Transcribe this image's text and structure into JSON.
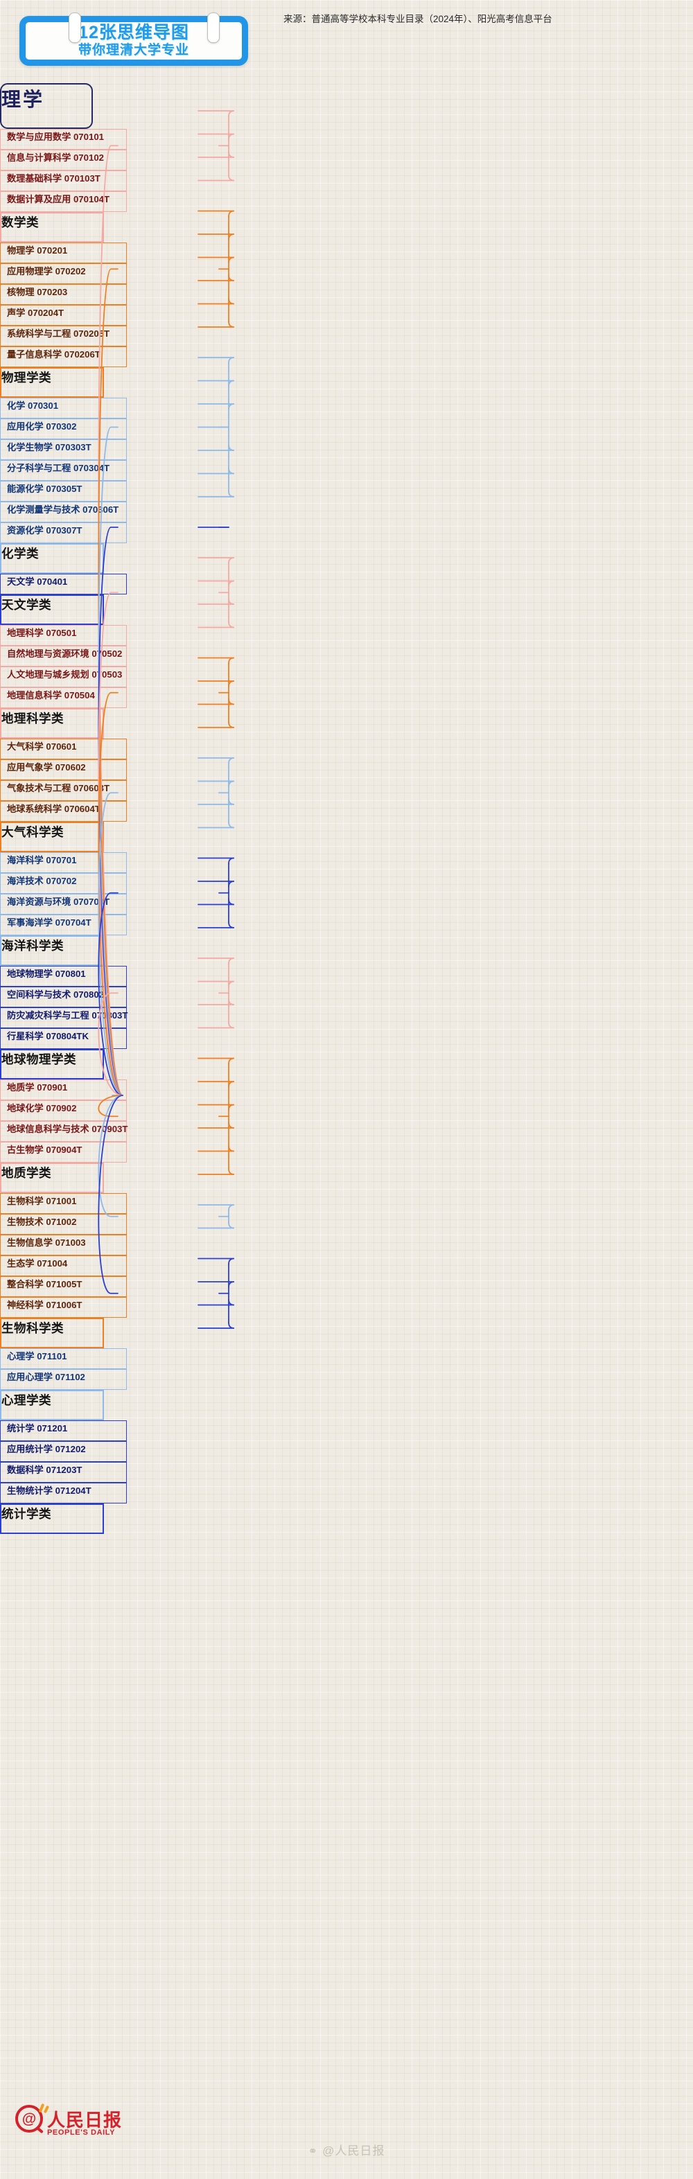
{
  "header": {
    "title_line1": "12张思维导图",
    "title_line2": "带你理清大学专业",
    "source": "来源：普通高等学校本科专业目录（2024年）、阳光高考信息平台"
  },
  "footer": {
    "logo_cn": "人民日报",
    "logo_en": "PEOPLE'S DAILY",
    "logo_mark": "@",
    "watermark": "@人民日报",
    "watermark_icon": "weibo-icon"
  },
  "mindmap": {
    "root": "理学",
    "root_color": "#262a62",
    "categories": [
      {
        "name": "数学类",
        "color": "#f4a9a3",
        "text_color": "#7b1516",
        "leaves": [
          "数学与应用数学 070101",
          "信息与计算科学 070102",
          "数理基础科学 070103T",
          "数据计算及应用 070104T"
        ]
      },
      {
        "name": "物理学类",
        "color": "#f07f22",
        "text_color": "#5e2409",
        "leaves": [
          "物理学 070201",
          "应用物理学 070202",
          "核物理 070203",
          "声学 070204T",
          "系统科学与工程 070205T",
          "量子信息科学 070206T"
        ]
      },
      {
        "name": "化学类",
        "color": "#8fb9ea",
        "text_color": "#10357a",
        "leaves": [
          "化学 070301",
          "应用化学 070302",
          "化学生物学 070303T",
          "分子科学与工程 070304T",
          "能源化学 070305T",
          "化学测量学与技术 070306T",
          "资源化学 070307T"
        ]
      },
      {
        "name": "天文学类",
        "color": "#2b3fd4",
        "text_color": "#101a6e",
        "leaves": [
          "天文学 070401"
        ]
      },
      {
        "name": "地理科学类",
        "color": "#f4a9a3",
        "text_color": "#7b1516",
        "leaves": [
          "地理科学 070501",
          "自然地理与资源环境 070502",
          "人文地理与城乡规划 070503",
          "地理信息科学 070504"
        ]
      },
      {
        "name": "大气科学类",
        "color": "#f07f22",
        "text_color": "#5e2409",
        "leaves": [
          "大气科学 070601",
          "应用气象学 070602",
          "气象技术与工程 070603T",
          "地球系统科学 070604T"
        ]
      },
      {
        "name": "海洋科学类",
        "color": "#8fb9ea",
        "text_color": "#10357a",
        "leaves": [
          "海洋科学 070701",
          "海洋技术 070702",
          "海洋资源与环境 070703T",
          "军事海洋学 070704T"
        ]
      },
      {
        "name": "地球物理学类",
        "color": "#2b3fd4",
        "text_color": "#101a6e",
        "leaves": [
          "地球物理学 070801",
          "空间科学与技术 070802",
          "防灾减灾科学与工程 070803T",
          "行星科学 070804TK"
        ]
      },
      {
        "name": "地质学类",
        "color": "#f4a9a3",
        "text_color": "#7b1516",
        "leaves": [
          "地质学 070901",
          "地球化学 070902",
          "地球信息科学与技术 070903T",
          "古生物学 070904T"
        ]
      },
      {
        "name": "生物科学类",
        "color": "#f07f22",
        "text_color": "#5e2409",
        "leaves": [
          "生物科学 071001",
          "生物技术 071002",
          "生物信息学 071003",
          "生态学 071004",
          "整合科学 071005T",
          "神经科学 071006T"
        ]
      },
      {
        "name": "心理学类",
        "color": "#8fb9ea",
        "text_color": "#10357a",
        "leaves": [
          "心理学 071101",
          "应用心理学 071102"
        ]
      },
      {
        "name": "统计学类",
        "color": "#2b3fd4",
        "text_color": "#101a6e",
        "leaves": [
          "统计学 071201",
          "应用统计学 071202",
          "数据科学 071203T",
          "生物统计学 071204T"
        ]
      }
    ]
  }
}
